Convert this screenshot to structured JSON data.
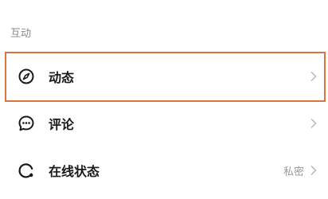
{
  "section": {
    "title": "互动"
  },
  "items": [
    {
      "label": "动态",
      "value": "",
      "icon": "compass-icon"
    },
    {
      "label": "评论",
      "value": "",
      "icon": "comment-bubble-icon"
    },
    {
      "label": "在线状态",
      "value": "私密",
      "icon": "online-status-icon"
    }
  ],
  "colors": {
    "highlight_border": "#d9733f",
    "secondary_text": "#9a9a9a"
  }
}
